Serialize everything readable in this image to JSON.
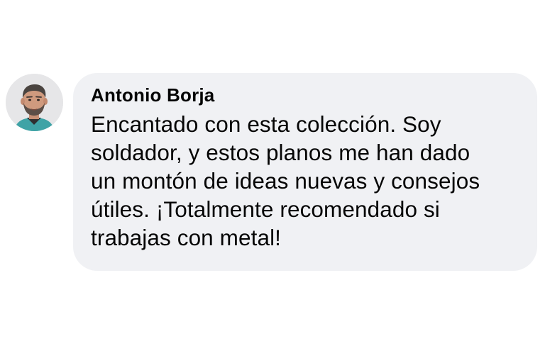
{
  "comment": {
    "author": "Antonio Borja",
    "text_lines": [
      "Encantado con esta colección. Soy",
      "soldador, y estos planos me han dado",
      "un montón de ideas nuevas y consejos",
      "útiles. ¡Totalmente recomendado si",
      "trabajas con metal!"
    ],
    "avatar_icon": "user-avatar-photo"
  },
  "colors": {
    "bubble_background": "#f0f1f4",
    "text": "#050505",
    "page_background": "#ffffff"
  }
}
